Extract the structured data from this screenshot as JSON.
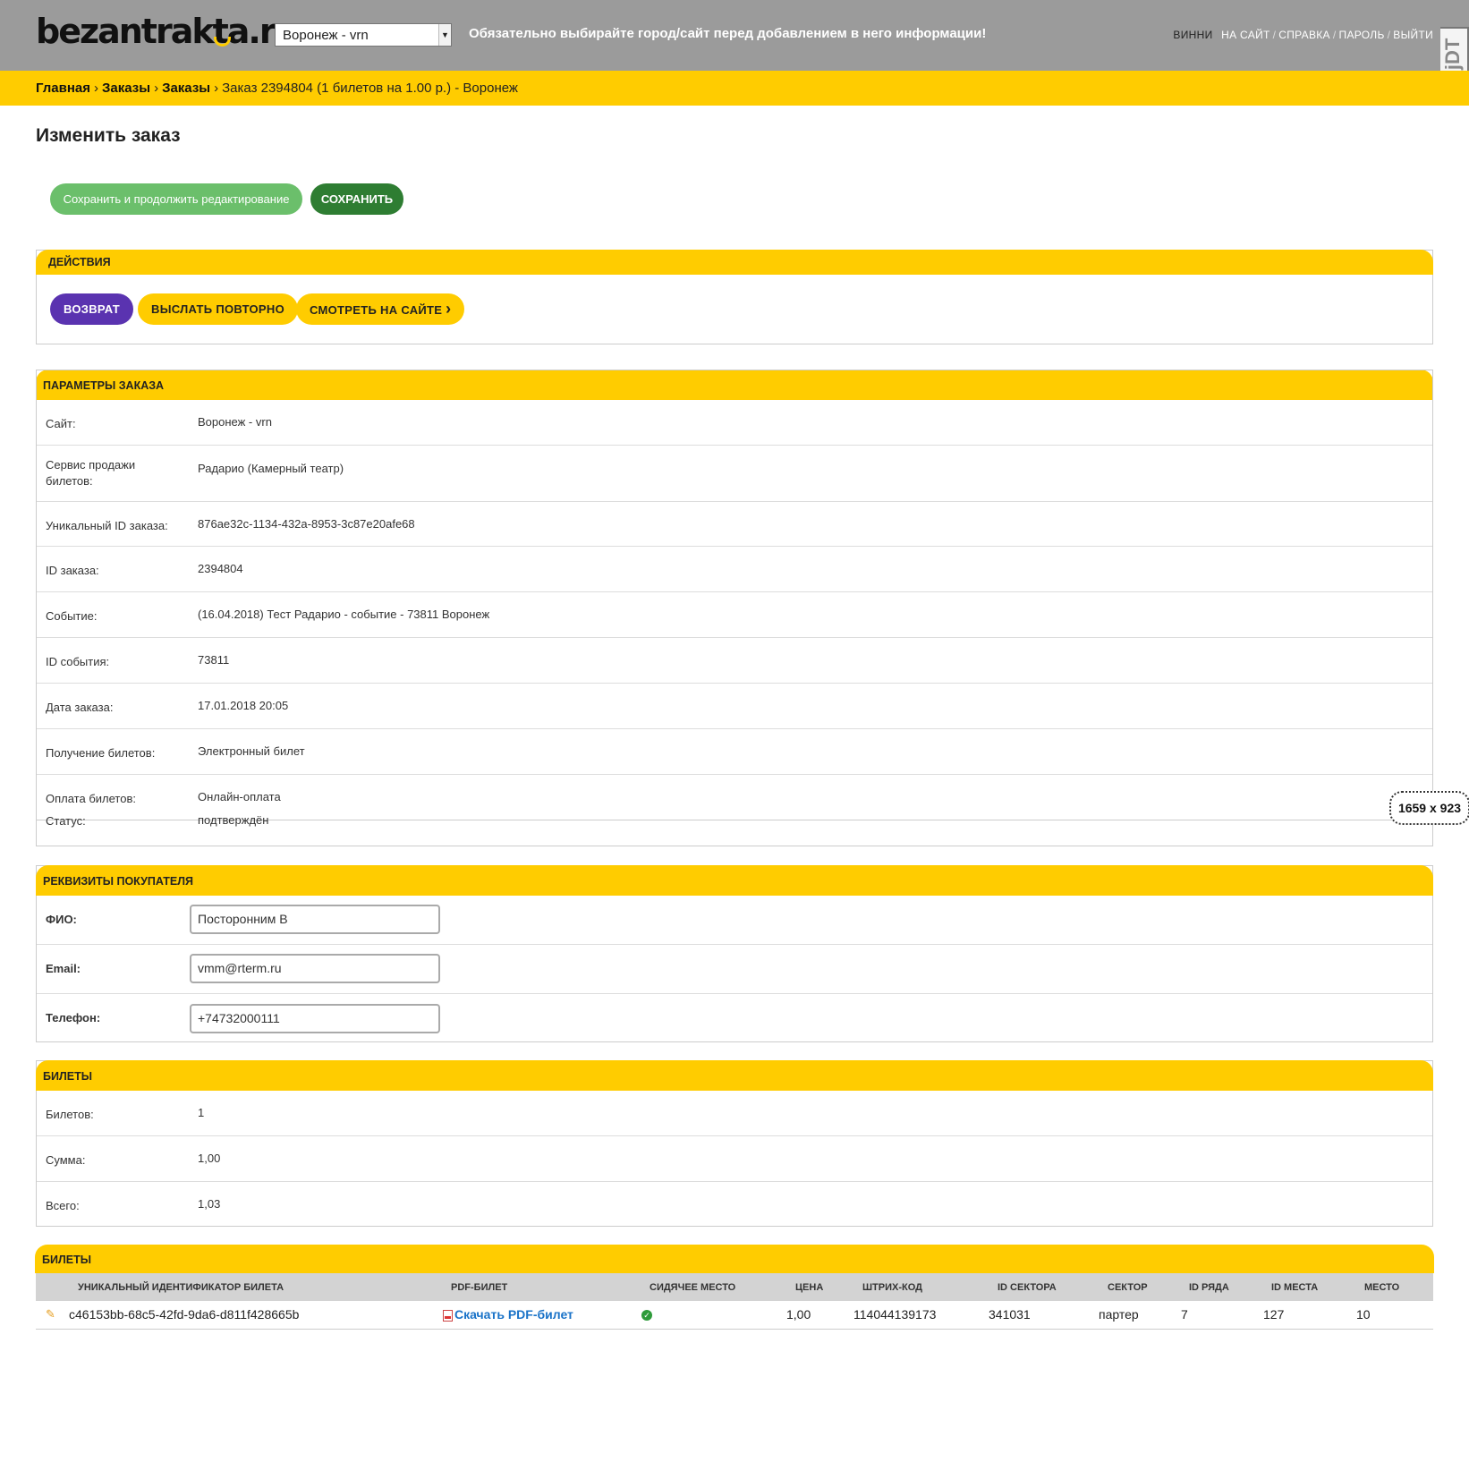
{
  "header": {
    "logo": "bezantrakta.ru",
    "logo_pre": "bezantrak",
    "logo_mark": "t",
    "logo_post": "a.ru",
    "site_select": "Воронеж - vrn",
    "notice": "Обязательно выбирайте город/сайт перед добавлением в него информации!",
    "welcome": "ВИННИ",
    "links": [
      "НА САЙТ",
      "СПРАВКА",
      "ПАРОЛЬ",
      "ВЫЙТИ"
    ],
    "sep": "/",
    "djdt": "DjDT"
  },
  "breadcrumbs": {
    "items": [
      "Главная",
      "Заказы",
      "Заказы"
    ],
    "current": "Заказ 2394804 (1 билетов на 1.00 р.) - Воронеж",
    "sep": "›"
  },
  "page_title": "Изменить заказ",
  "buttons": {
    "save_continue": "Сохранить и продолжить редактирование",
    "save": "СОХРАНИТЬ"
  },
  "actions": {
    "title": "ДЕЙСТВИЯ",
    "refund": "ВОЗВРАТ",
    "resend": "ВЫСЛАТЬ ПОВТОРНО",
    "view_on_site": "СМОТРЕТЬ НА САЙТЕ",
    "view_icon": "›"
  },
  "params": {
    "title": "ПАРАМЕТРЫ ЗАКАЗА",
    "rows": [
      {
        "label": "Сайт:",
        "value": "Воронеж - vrn"
      },
      {
        "label": "Сервис продажи билетов:",
        "value": "Радарио (Камерный театр)"
      },
      {
        "label": "Уникальный ID заказа:",
        "value": "876ae32c-1134-432a-8953-3c87e20afe68"
      },
      {
        "label": "ID заказа:",
        "value": "2394804"
      },
      {
        "label": "Событие:",
        "value": "(16.04.2018) Тест Радарио - событие - 73811 Воронеж"
      },
      {
        "label": "ID события:",
        "value": "73811"
      },
      {
        "label": "Дата заказа:",
        "value": "17.01.2018 20:05"
      },
      {
        "label": "Получение билетов:",
        "value": "Электронный билет"
      },
      {
        "label": "Оплата билетов:",
        "value": "Онлайн-оплата"
      },
      {
        "label": "Статус:",
        "value": "подтверждён"
      }
    ]
  },
  "buyer": {
    "title": "РЕКВИЗИТЫ ПОКУПАТЕЛЯ",
    "name_label": "ФИО:",
    "name_value": "Посторонним В",
    "email_label": "Email:",
    "email_value": "vmm@rterm.ru",
    "phone_label": "Телефон:",
    "phone_value": "+74732000111"
  },
  "tickets_summary": {
    "title": "БИЛЕТЫ",
    "rows": [
      {
        "label": "Билетов:",
        "value": "1"
      },
      {
        "label": "Сумма:",
        "value": "1,00"
      },
      {
        "label": "Всего:",
        "value": "1,03"
      }
    ]
  },
  "tickets_table": {
    "title": "БИЛЕТЫ",
    "columns": [
      "УНИКАЛЬНЫЙ ИДЕНТИФИКАТОР БИЛЕТА",
      "PDF-БИЛЕТ",
      "СИДЯЧЕЕ МЕСТО",
      "ЦЕНА",
      "ШТРИХ-КОД",
      "ID СЕКТОРА",
      "СЕКТОР",
      "ID РЯДА",
      "ID МЕСТА",
      "МЕСТО"
    ],
    "row": {
      "uuid": "c46153bb-68c5-42fd-9da6-d811f428665b",
      "pdf": "Скачать PDF-билет",
      "price": "1,00",
      "barcode": "114044139173",
      "sector_id": "341031",
      "sector": "партер",
      "row_id": "7",
      "seat_id": "127",
      "seat": "10"
    }
  },
  "size_badge": "1659 x 923",
  "colors": {
    "header_bg": "#9b9b9b",
    "accent": "#ffcc00",
    "save_green": "#2e7d32",
    "save_continue_green": "#6bbf6b",
    "refund_purple": "#5a33b0",
    "link_blue": "#1a73c8"
  },
  "icons": {
    "edit": "pencil-icon",
    "pdf": "pdf-file-icon",
    "seated": "check-circle-icon",
    "select_arrow": "chevron-down-icon"
  }
}
